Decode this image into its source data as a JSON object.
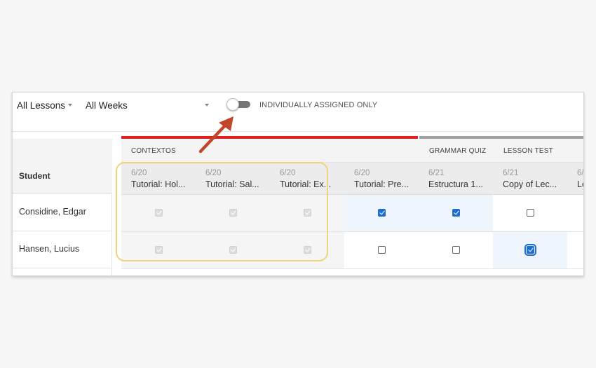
{
  "toolbar": {
    "lessons_filter": "All Lessons",
    "weeks_filter": "All Weeks",
    "toggle_label": "INDIVIDUALLY ASSIGNED ONLY",
    "toggle_on": false
  },
  "table": {
    "student_header": "Student",
    "groups": [
      {
        "label": "CONTEXTOS",
        "bar_color": "#e02020"
      },
      {
        "label": "GRAMMAR QUIZ",
        "bar_color": "#a0a0a0"
      },
      {
        "label": "LESSON TEST",
        "bar_color": "#a0a0a0"
      }
    ],
    "columns": [
      {
        "date": "6/20",
        "title": "Tutorial: Hol..."
      },
      {
        "date": "6/20",
        "title": "Tutorial: Sal..."
      },
      {
        "date": "6/20",
        "title": "Tutorial: Ex..."
      },
      {
        "date": "6/20",
        "title": "Tutorial: Pre..."
      },
      {
        "date": "6/21",
        "title": "Estructura 1..."
      },
      {
        "date": "6/21",
        "title": "Copy of Lec..."
      },
      {
        "date": "6/",
        "title": "Le"
      }
    ],
    "rows": [
      {
        "student": "Considine, Edgar",
        "cells": [
          "disabled-checked",
          "disabled-checked",
          "disabled-checked",
          "checked",
          "checked",
          "unchecked"
        ]
      },
      {
        "student": "Hansen, Lucius",
        "cells": [
          "disabled-checked",
          "disabled-checked",
          "disabled-checked",
          "unchecked",
          "unchecked",
          "checked-focus"
        ]
      }
    ]
  },
  "colors": {
    "accent_blue": "#1f6dd1",
    "annotation_arrow": "#c0472a",
    "highlight": "#f0d37b"
  }
}
